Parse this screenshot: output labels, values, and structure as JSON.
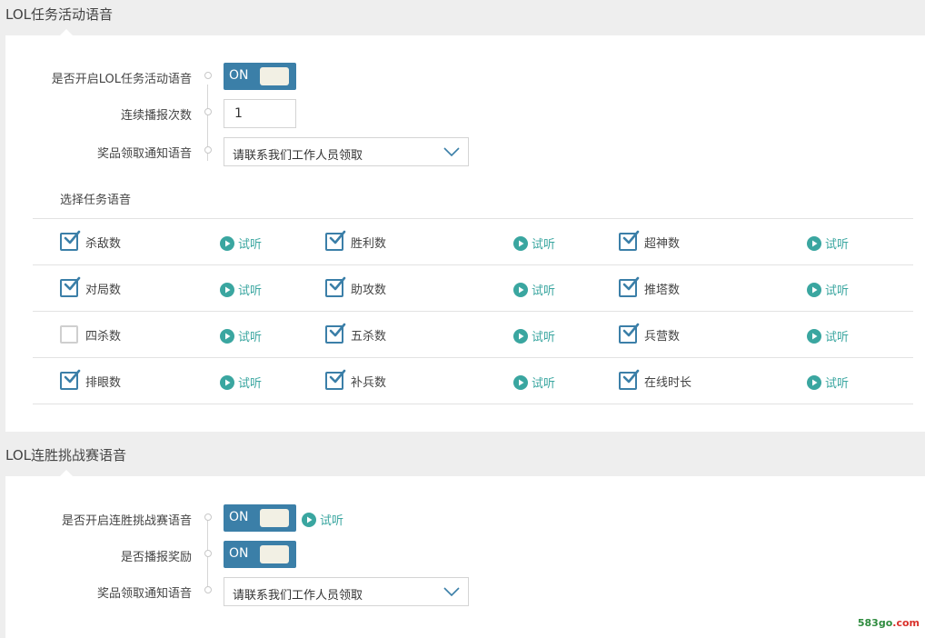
{
  "section1": {
    "title": "LOL任务活动语音",
    "enable_label": "是否开启LOL任务活动语音",
    "enable_toggle": "ON",
    "repeat_label": "连续播报次数",
    "repeat_value": "1",
    "prize_label": "奖品领取通知语音",
    "prize_value": "请联系我们工作人员领取",
    "choose_label": "选择任务语音",
    "listen_label": "试听",
    "grid": [
      [
        {
          "label": "杀敌数",
          "checked": true
        },
        {
          "label": "胜利数",
          "checked": true
        },
        {
          "label": "超神数",
          "checked": true
        }
      ],
      [
        {
          "label": "对局数",
          "checked": true
        },
        {
          "label": "助攻数",
          "checked": true
        },
        {
          "label": "推塔数",
          "checked": true
        }
      ],
      [
        {
          "label": "四杀数",
          "checked": false
        },
        {
          "label": "五杀数",
          "checked": true
        },
        {
          "label": "兵营数",
          "checked": true
        }
      ],
      [
        {
          "label": "排眼数",
          "checked": true
        },
        {
          "label": "补兵数",
          "checked": true
        },
        {
          "label": "在线时长",
          "checked": true
        }
      ]
    ]
  },
  "section2": {
    "title": "LOL连胜挑战赛语音",
    "enable_label": "是否开启连胜挑战赛语音",
    "enable_toggle": "ON",
    "listen_label": "试听",
    "reward_label": "是否播报奖励",
    "reward_toggle": "ON",
    "prize_label": "奖品领取通知语音",
    "prize_value": "请联系我们工作人员领取"
  },
  "watermark": {
    "part1": "583go",
    "part2": ".com"
  },
  "colors": {
    "accent": "#3b7fa8",
    "listen": "#3aa6a0",
    "knob": "#f2f0e4"
  }
}
